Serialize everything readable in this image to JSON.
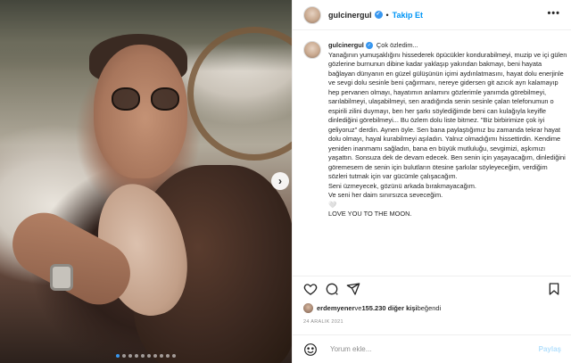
{
  "post": {
    "username": "gulcinergul",
    "separator": "•",
    "follow_label": "Takip Et",
    "more_label": "•••",
    "verified_glyph": "✓"
  },
  "caption": {
    "username": "gulcinergul",
    "paragraphs": [
      "Çok özledim...",
      "Yanağının yumuşaklığını hissederek öpücükler kondurabilmeyi, muzip ve içi gülen gözlerine burnunun dibine kadar yaklaşıp yakından bakmayı, beni hayata bağlayan dünyanın en güzel gülüşünün içimi aydınlatmasını, hayat dolu enerjinle ve sevgi dolu sesinle beni çağırmanı, nereye gidersen git azıcık ayrı kalamayıp hep pervanen olmayı, hayatımın anlamını gözlerimle yanımda görebilmeyi, sarılabilmeyi, ulaşabilmeyi, sen aradığında senin sesinle çalan telefonumun o espirili zilini duymayı, ben her şarkı söylediğimde beni can kulağıyla keyifle dinlediğini görebilmeyi... Bu özlem dolu liste bitmez. \"Biz birbirimize çok iyi geliyoruz\" derdin. Aynen öyle. Sen bana paylaştığımız bu zamanda tekrar hayat dolu olmayı, hayal kurabilmeyi aşıladın. Yalnız olmadığımı hissettirdin. Kendime yeniden inanmamı sağladın, bana en büyük mutluluğu, sevgimizi, aşkımızı yaşattın. Sonsuza dek de devam edecek. Ben senin için yaşayacağım, dinlediğini göremesem de senin için bulutların ötesine şarkılar söyleyeceğim, verdiğim sözleri tutmak için var gücümle çalışacağım.",
      "Seni üzmeyecek, gözünü arkada bırakmayacağım.",
      "Ve seni her daim sınırsızca seveceğim.",
      "🤍",
      "LOVE YOU TO THE MOON."
    ]
  },
  "likes": {
    "user": "erdemyener",
    "connector": " ve ",
    "count_text": "155.230 diğer kişi",
    "suffix": " beğendi"
  },
  "date": "24 ARALIK 2021",
  "comment": {
    "placeholder": "Yorum ekle...",
    "share_label": "Paylaş"
  },
  "carousel": {
    "slides": 10,
    "active_index": 0,
    "next_glyph": "›"
  },
  "colors": {
    "accent": "#0095f6",
    "verified": "#3897f0",
    "text": "#262626",
    "muted": "#8e8e8e",
    "border": "#efefef"
  }
}
